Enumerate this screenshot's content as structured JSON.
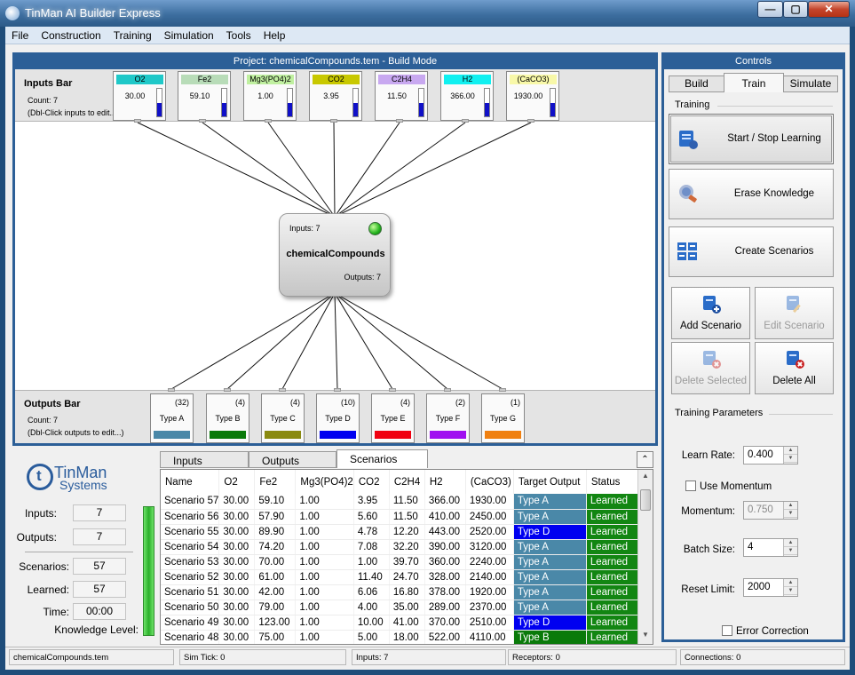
{
  "window": {
    "title": "TinMan AI Builder Express",
    "min_label": "—",
    "max_label": "▢",
    "close_label": "✕"
  },
  "menu": [
    "File",
    "Construction",
    "Training",
    "Simulation",
    "Tools",
    "Help"
  ],
  "build": {
    "header": "Project: chemicalCompounds.tem - Build Mode",
    "inputs_bar": {
      "title": "Inputs Bar",
      "count": "Count: 7",
      "hint": "(Dbl-Click inputs to edit...)"
    },
    "outputs_bar": {
      "title": "Outputs Bar",
      "count": "Count: 7",
      "hint": "(Dbl-Click outputs to edit...)"
    },
    "inputs": [
      {
        "name": "O2",
        "value": "30.00",
        "color": "#1fc8c8"
      },
      {
        "name": "Fe2",
        "value": "59.10",
        "color": "#b8dcb8"
      },
      {
        "name": "Mg3(PO4)2",
        "value": "1.00",
        "color": "#c0f0a0"
      },
      {
        "name": "CO2",
        "value": "3.95",
        "color": "#c8c800"
      },
      {
        "name": "C2H4",
        "value": "11.50",
        "color": "#c8a8f0"
      },
      {
        "name": "H2",
        "value": "366.00",
        "color": "#10f0f0"
      },
      {
        "name": "(CaCO3)",
        "value": "1930.00",
        "color": "#f8f8a8"
      }
    ],
    "network": {
      "inputs_label": "Inputs: 7",
      "name": "chemicalCompounds",
      "outputs_label": "Outputs: 7"
    },
    "outputs": [
      {
        "name": "Type A",
        "count": "(32)",
        "color": "#4a88a8"
      },
      {
        "name": "Type B",
        "count": "(4)",
        "color": "#0a7a0a"
      },
      {
        "name": "Type C",
        "count": "(4)",
        "color": "#8a8a10"
      },
      {
        "name": "Type D",
        "count": "(10)",
        "color": "#0000f0"
      },
      {
        "name": "Type E",
        "count": "(4)",
        "color": "#f00010"
      },
      {
        "name": "Type F",
        "count": "(2)",
        "color": "#a010f0"
      },
      {
        "name": "Type G",
        "count": "(1)",
        "color": "#f08010"
      }
    ]
  },
  "stats": {
    "inputs_label": "Inputs:",
    "inputs": "7",
    "outputs_label": "Outputs:",
    "outputs": "7",
    "scenarios_label": "Scenarios:",
    "scenarios": "57",
    "learned_label": "Learned:",
    "learned": "57",
    "time_label": "Time:",
    "time": "00:00",
    "knowledge_label": "Knowledge Level:"
  },
  "logo": {
    "mark": "t",
    "line1": "TinMan",
    "line2": "Systems"
  },
  "data_tabs": [
    "Inputs",
    "Outputs",
    "Scenarios"
  ],
  "collapse_label": "⌃",
  "grid": {
    "columns": [
      "Name",
      "O2",
      "Fe2",
      "Mg3(PO4)2",
      "CO2",
      "C2H4",
      "H2",
      "(CaCO3)",
      "Target Output",
      "Status"
    ],
    "rows": [
      {
        "cells": [
          "Scenario 57",
          "30.00",
          "59.10",
          "1.00",
          "3.95",
          "11.50",
          "366.00",
          "1930.00",
          "Type A",
          "Learned"
        ],
        "color": "#4a88a8"
      },
      {
        "cells": [
          "Scenario 56",
          "30.00",
          "57.90",
          "1.00",
          "5.60",
          "11.50",
          "410.00",
          "2450.00",
          "Type A",
          "Learned"
        ],
        "color": "#4a88a8"
      },
      {
        "cells": [
          "Scenario 55",
          "30.00",
          "89.90",
          "1.00",
          "4.78",
          "12.20",
          "443.00",
          "2520.00",
          "Type D",
          "Learned"
        ],
        "color": "#0000f0"
      },
      {
        "cells": [
          "Scenario 54",
          "30.00",
          "74.20",
          "1.00",
          "7.08",
          "32.20",
          "390.00",
          "3120.00",
          "Type A",
          "Learned"
        ],
        "color": "#4a88a8"
      },
      {
        "cells": [
          "Scenario 53",
          "30.00",
          "70.00",
          "1.00",
          "1.00",
          "39.70",
          "360.00",
          "2240.00",
          "Type A",
          "Learned"
        ],
        "color": "#4a88a8"
      },
      {
        "cells": [
          "Scenario 52",
          "30.00",
          "61.00",
          "1.00",
          "11.40",
          "24.70",
          "328.00",
          "2140.00",
          "Type A",
          "Learned"
        ],
        "color": "#4a88a8"
      },
      {
        "cells": [
          "Scenario 51",
          "30.00",
          "42.00",
          "1.00",
          "6.06",
          "16.80",
          "378.00",
          "1920.00",
          "Type A",
          "Learned"
        ],
        "color": "#4a88a8"
      },
      {
        "cells": [
          "Scenario 50",
          "30.00",
          "79.00",
          "1.00",
          "4.00",
          "35.00",
          "289.00",
          "2370.00",
          "Type A",
          "Learned"
        ],
        "color": "#4a88a8"
      },
      {
        "cells": [
          "Scenario 49",
          "30.00",
          "123.00",
          "1.00",
          "10.00",
          "41.00",
          "370.00",
          "2510.00",
          "Type D",
          "Learned"
        ],
        "color": "#0000f0"
      },
      {
        "cells": [
          "Scenario 48",
          "30.00",
          "75.00",
          "1.00",
          "5.00",
          "18.00",
          "522.00",
          "4110.00",
          "Type B",
          "Learned"
        ],
        "color": "#0a7a0a"
      }
    ]
  },
  "controls": {
    "header": "Controls",
    "tabs": [
      "Build",
      "Train",
      "Simulate"
    ],
    "training_group": "Training",
    "start_stop": "Start / Stop Learning",
    "erase": "Erase Knowledge",
    "create_scenarios": "Create Scenarios",
    "add_scenario": "Add Scenario",
    "edit_scenario": "Edit Scenario",
    "delete_selected": "Delete Selected",
    "delete_all": "Delete All",
    "params_group": "Training Parameters",
    "learn_rate_label": "Learn Rate:",
    "learn_rate": "0.400",
    "use_momentum_label": "Use Momentum",
    "momentum_label": "Momentum:",
    "momentum": "0.750",
    "batch_size_label": "Batch Size:",
    "batch_size": "4",
    "reset_limit_label": "Reset Limit:",
    "reset_limit": "2000",
    "error_correction_label": "Error Correction"
  },
  "status": {
    "file": "chemicalCompounds.tem",
    "sim_tick": "Sim Tick: 0",
    "inputs": "Inputs: 7",
    "receptors": "Receptors: 0",
    "connections": "Connections: 0"
  }
}
